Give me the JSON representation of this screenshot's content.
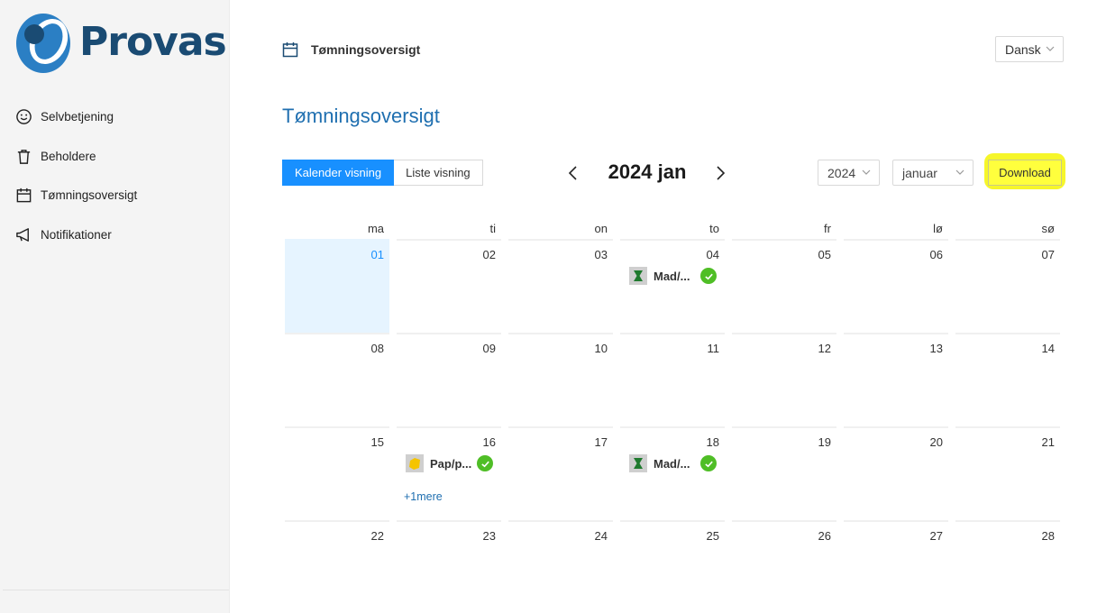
{
  "brand": {
    "name": "Provas",
    "colors": {
      "primary": "#1a4b73",
      "accent": "#1890ff",
      "highlight": "#ffff3d",
      "done": "#4fbe26"
    }
  },
  "sidebar": {
    "items": [
      {
        "label": "Selvbetjening",
        "icon": "smile-icon"
      },
      {
        "label": "Beholdere",
        "icon": "trash-icon"
      },
      {
        "label": "Tømningsoversigt",
        "icon": "calendar-icon"
      },
      {
        "label": "Notifikationer",
        "icon": "megaphone-icon"
      }
    ]
  },
  "topbar": {
    "title": "Tømningsoversigt",
    "icon": "calendar-icon",
    "language": "Dansk"
  },
  "page": {
    "title": "Tømningsoversigt"
  },
  "toolbar": {
    "views": [
      {
        "label": "Kalender visning",
        "active": true
      },
      {
        "label": "Liste visning",
        "active": false
      }
    ],
    "current_period": "2024 jan",
    "year": "2024",
    "month": "januar",
    "download_label": "Download"
  },
  "calendar": {
    "weekdays": [
      "ma",
      "ti",
      "on",
      "to",
      "fr",
      "lø",
      "sø"
    ],
    "today": "01",
    "weeks": [
      [
        {
          "day": "01"
        },
        {
          "day": "02"
        },
        {
          "day": "03"
        },
        {
          "day": "04",
          "event": {
            "label": "Mad/...",
            "type": "food"
          }
        },
        {
          "day": "05"
        },
        {
          "day": "06"
        },
        {
          "day": "07"
        }
      ],
      [
        {
          "day": "08"
        },
        {
          "day": "09"
        },
        {
          "day": "10"
        },
        {
          "day": "11"
        },
        {
          "day": "12"
        },
        {
          "day": "13"
        },
        {
          "day": "14"
        }
      ],
      [
        {
          "day": "15"
        },
        {
          "day": "16",
          "event": {
            "label": "Pap/p...",
            "type": "paper"
          },
          "more": "+1mere"
        },
        {
          "day": "17"
        },
        {
          "day": "18",
          "event": {
            "label": "Mad/...",
            "type": "food"
          }
        },
        {
          "day": "19"
        },
        {
          "day": "20"
        },
        {
          "day": "21"
        }
      ],
      [
        {
          "day": "22"
        },
        {
          "day": "23"
        },
        {
          "day": "24"
        },
        {
          "day": "25"
        },
        {
          "day": "26"
        },
        {
          "day": "27"
        },
        {
          "day": "28"
        }
      ]
    ]
  }
}
